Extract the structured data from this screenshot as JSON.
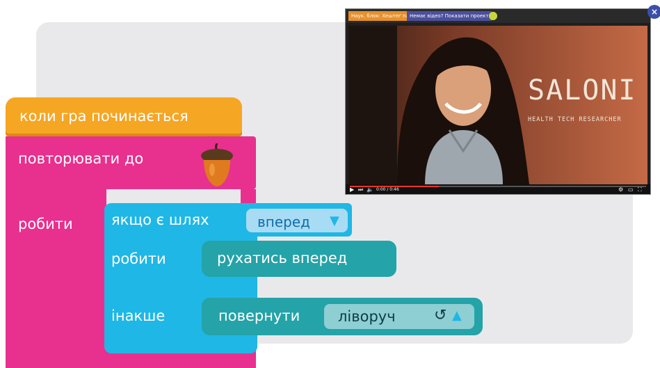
{
  "blocks": {
    "event_label": "коли гра починається",
    "repeat_label": "повторювати до",
    "repeat_do_label": "робити",
    "if_label": "якщо є шлях",
    "if_direction": "вперед",
    "if_do_label": "робити",
    "else_label": "інакше",
    "move_label": "рухатись вперед",
    "turn_label": "повернути",
    "turn_direction": "ліворуч",
    "turn_rotate_glyph": "↺",
    "dropdown_arrow_down": "▼",
    "dropdown_arrow_up": "▲"
  },
  "video": {
    "tabs": [
      "Наук. блок: Хештеґ пам'яті",
      "Немає відео? Показати проектик"
    ],
    "close": "×",
    "name": "SALONI",
    "caption": "HEALTH TECH RESEARCHER",
    "time": "0:00 / 0:46",
    "progress_percent": 30
  },
  "colors": {
    "event": "#f5a623",
    "loop": "#e8308f",
    "logic": "#1fb7e6",
    "motion": "#24a3a8"
  },
  "icons": [
    "acorn-icon",
    "close-icon",
    "play-icon",
    "volume-icon",
    "fullscreen-icon"
  ]
}
